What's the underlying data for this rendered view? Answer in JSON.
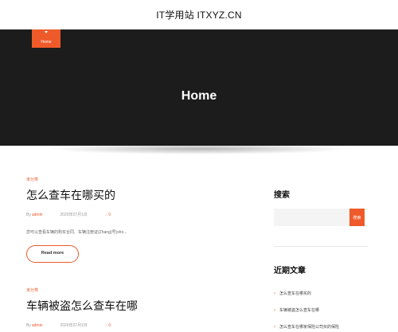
{
  "header": {
    "site_title": "IT学用站 ITXYZ.CN"
  },
  "nav": {
    "home_tab": "Home"
  },
  "hero": {
    "title": "Home"
  },
  "posts": [
    {
      "category": "未分类",
      "title": "怎么查车在哪买的",
      "author": "admin",
      "date": "2020年07月1日",
      "comments": "0",
      "excerpt": "您可以查看车辆的购买合同、车辆注册证(Zhang)号(sho...",
      "read_more": "Read more"
    },
    {
      "category": "未分类",
      "title": "车辆被盗怎么查车在哪",
      "author": "admin",
      "date": "2020年07月1日",
      "comments": "0"
    }
  ],
  "sidebar": {
    "search_heading": "搜索",
    "search_placeholder": "",
    "search_button": "搜索",
    "recent_heading": "近期文章",
    "recent_posts": [
      "怎么查车在哪买的",
      "车辆被盗怎么查车在哪",
      "怎么查车在哪家保险公司买的保险"
    ]
  },
  "colors": {
    "accent": "#ee5a2a",
    "hero_bg": "#1c1c1c"
  },
  "icons": {
    "author": "user-icon",
    "date": "calendar-icon",
    "comments": "comment-icon",
    "recent": "arrow-right-icon"
  }
}
